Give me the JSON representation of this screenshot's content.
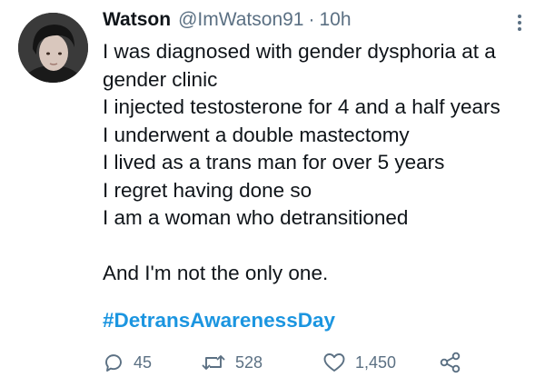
{
  "tweet": {
    "display_name": "Watson",
    "handle": "@ImWatson91",
    "separator": "·",
    "timestamp": "10h",
    "lines": [
      "I was diagnosed with gender dysphoria at a",
      "gender clinic",
      "I injected testosterone for 4 and a half years",
      "I underwent a double mastectomy",
      "I lived as a trans man for over 5 years",
      "I regret having done so",
      "I am a woman who detransitioned"
    ],
    "closing_line": "And I'm not the only one.",
    "hashtag": "#DetransAwarenessDay"
  },
  "actions": {
    "replies": "45",
    "retweets": "528",
    "likes": "1,450"
  },
  "icons": {
    "reply": "speech-bubble-icon",
    "retweet": "retweet-arrows-icon",
    "like": "heart-outline-icon",
    "share": "share-nodes-icon",
    "more": "vertical-dots-icon"
  },
  "colors": {
    "hashtag": "#1b95e0",
    "secondary_text": "#5b7083",
    "primary_text": "#0f1419"
  }
}
